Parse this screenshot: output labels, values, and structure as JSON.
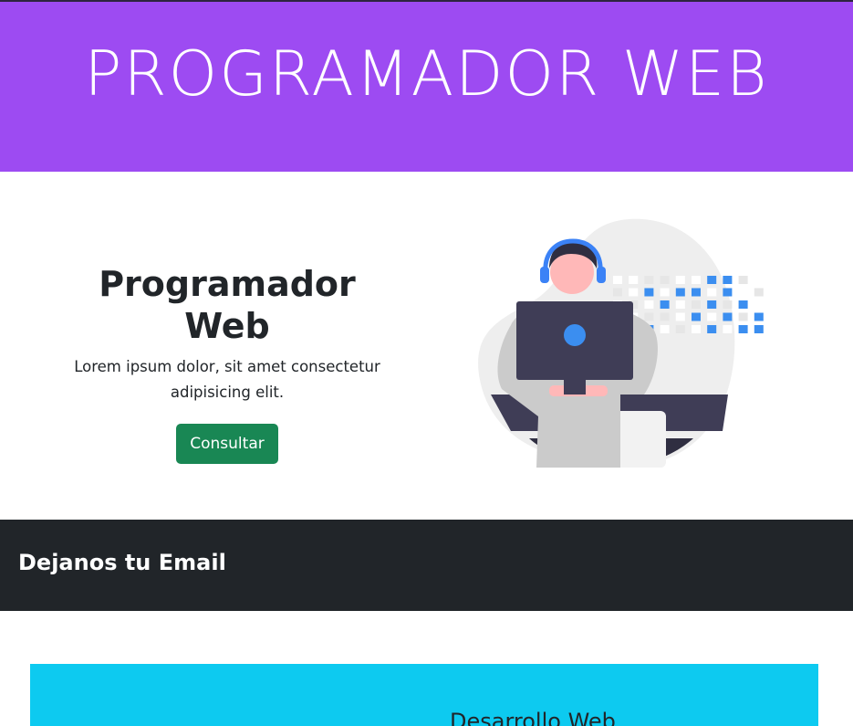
{
  "banner": {
    "title": "PROGRAMADOR WEB",
    "color": "#9d4bf2"
  },
  "hero": {
    "title": "Programador Web",
    "description": "Lorem ipsum dolor, sit amet consectetur adipisicing elit.",
    "button_label": "Consultar",
    "button_color": "#198754",
    "illustration": "developer-at-computer-illustration"
  },
  "email_section": {
    "title": "Dejanos tu Email",
    "background": "#212529"
  },
  "services": {
    "card_title": "Desarrollo Web",
    "background": "#0dcaf0"
  }
}
